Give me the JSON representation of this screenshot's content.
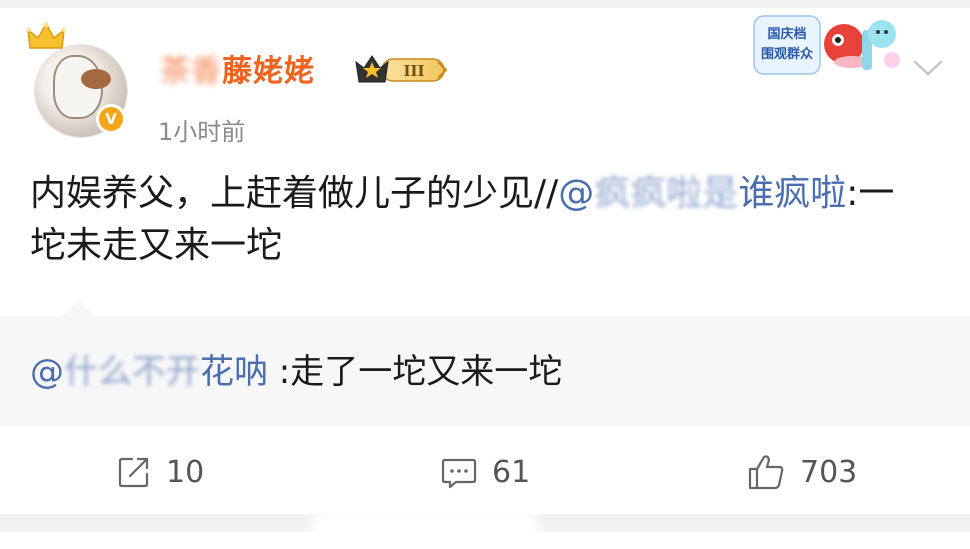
{
  "post": {
    "username": "茶香藤姥姥",
    "username_visible": "藤姥姥",
    "username_blur": "茶香",
    "level_badge": "III",
    "time": "1小时前",
    "event_badge_text_1": "国庆档",
    "event_badge_text_2": "围观群众",
    "text_main": "内娱养父，上赶着做儿子的少见//",
    "mention_at": "@",
    "mention_name_blur": "疯疯啦是",
    "mention_name_visible": "谁疯啦",
    "text_after_mention": ":一坨未走又来一坨"
  },
  "repost": {
    "mention_at": "@",
    "mention_name_blur": "什么不开",
    "mention_name_visible": "花呐",
    "text": " :走了一坨又来一坨"
  },
  "actions": {
    "share_count": "10",
    "comment_count": "61",
    "like_count": "703"
  },
  "colors": {
    "username": "#f0631f",
    "mention": "#4a6eb0",
    "text": "#1a1a1a",
    "meta": "#8a8a8a"
  },
  "icons": [
    "crown-icon",
    "verified-badge-icon",
    "level-badge-icon",
    "event-badge-icon",
    "chevron-down-icon",
    "share-icon",
    "comment-icon",
    "like-icon"
  ]
}
